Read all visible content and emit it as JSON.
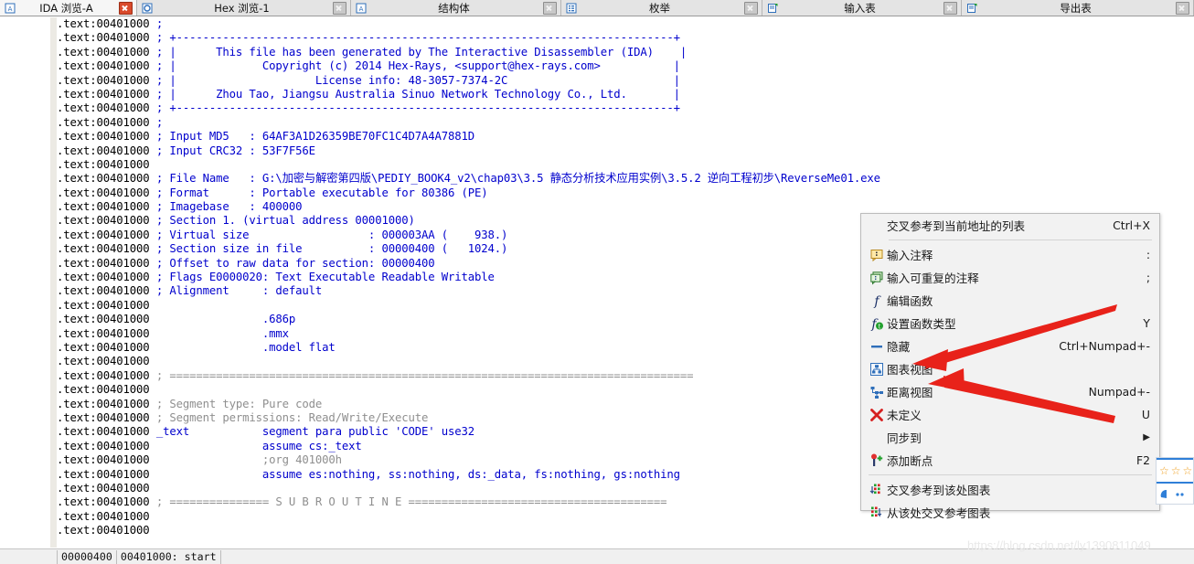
{
  "tabs": [
    {
      "label": "IDA 浏览-A",
      "icon": "ida-view-icon",
      "active": true,
      "close": "close-icon",
      "close_style": "red"
    },
    {
      "label": "Hex 浏览-1",
      "icon": "hex-view-icon",
      "active": false,
      "close": "close-icon",
      "close_style": "grey"
    },
    {
      "label": "结构体",
      "icon": "structures-icon",
      "active": false,
      "close": "close-icon",
      "close_style": "grey"
    },
    {
      "label": "枚举",
      "icon": "enums-icon",
      "active": false,
      "close": "close-icon",
      "close_style": "grey"
    },
    {
      "label": "输入表",
      "icon": "imports-icon",
      "active": false,
      "close": "close-icon",
      "close_style": "grey"
    },
    {
      "label": "导出表",
      "icon": "exports-icon",
      "active": false,
      "close": "close-icon",
      "close_style": "grey"
    }
  ],
  "disassembly": {
    "address_prefix": ".text:00401000",
    "lines": [
      {
        "color": "blue",
        "text": ";"
      },
      {
        "color": "blue",
        "text": "; +---------------------------------------------------------------------------+"
      },
      {
        "color": "blue",
        "text": "; |      This file has been generated by The Interactive Disassembler (IDA)    |"
      },
      {
        "color": "blue",
        "text": "; |             Copyright (c) 2014 Hex-Rays, <support@hex-rays.com>           |"
      },
      {
        "color": "blue",
        "text": "; |                     License info: 48-3057-7374-2C                         |"
      },
      {
        "color": "blue",
        "text": "; |      Zhou Tao, Jiangsu Australia Sinuo Network Technology Co., Ltd.       |"
      },
      {
        "color": "blue",
        "text": "; +---------------------------------------------------------------------------+"
      },
      {
        "color": "blue",
        "text": ";"
      },
      {
        "color": "blue",
        "text": "; Input MD5   : 64AF3A1D26359BE70FC1C4D7A4A7881D"
      },
      {
        "color": "blue",
        "text": "; Input CRC32 : 53F7F56E"
      },
      {
        "color": "blue",
        "text": ""
      },
      {
        "color": "blue",
        "text": "; File Name   : G:\\加密与解密第四版\\PEDIY_BOOK4_v2\\chap03\\3.5 静态分析技术应用实例\\3.5.2 逆向工程初步\\ReverseMe01.exe"
      },
      {
        "color": "blue",
        "text": "; Format      : Portable executable for 80386 (PE)"
      },
      {
        "color": "blue",
        "text": "; Imagebase   : 400000"
      },
      {
        "color": "blue",
        "text": "; Section 1. (virtual address 00001000)"
      },
      {
        "color": "blue",
        "text": "; Virtual size                  : 000003AA (    938.)"
      },
      {
        "color": "blue",
        "text": "; Section size in file          : 00000400 (   1024.)"
      },
      {
        "color": "blue",
        "text": "; Offset to raw data for section: 00000400"
      },
      {
        "color": "blue",
        "text": "; Flags E0000020: Text Executable Readable Writable"
      },
      {
        "color": "blue",
        "text": "; Alignment     : default"
      },
      {
        "color": "blue",
        "text": ""
      },
      {
        "color": "blue",
        "text": "                .686p"
      },
      {
        "color": "blue",
        "text": "                .mmx"
      },
      {
        "color": "blue",
        "text": "                .model flat"
      },
      {
        "color": "blue",
        "text": ""
      },
      {
        "color": "grey",
        "text": "; ==============================================================================="
      },
      {
        "color": "blue",
        "text": ""
      },
      {
        "color": "grey",
        "text": "; Segment type: Pure code"
      },
      {
        "color": "grey",
        "text": "; Segment permissions: Read/Write/Execute"
      },
      {
        "color": "blue",
        "text": "_text           segment para public 'CODE' use32"
      },
      {
        "color": "blue",
        "text": "                assume cs:_text"
      },
      {
        "color": "grey",
        "text": "                ;org 401000h"
      },
      {
        "color": "blue",
        "text": "                assume es:nothing, ss:nothing, ds:_data, fs:nothing, gs:nothing"
      },
      {
        "color": "blue",
        "text": ""
      },
      {
        "color": "grey",
        "text": "; =============== S U B R O U T I N E ======================================="
      },
      {
        "color": "blue",
        "text": ""
      },
      {
        "color": "blue",
        "text": ""
      }
    ]
  },
  "context_menu": {
    "items": [
      {
        "icon": null,
        "label": "交叉参考到当前地址的列表",
        "shortcut": "Ctrl+X",
        "submenu": false
      },
      {
        "separator": true
      },
      {
        "icon": "comment-bubble-icon",
        "label": "输入注释",
        "shortcut": ":",
        "submenu": false
      },
      {
        "icon": "repeatable-comment-icon",
        "label": "输入可重复的注释",
        "shortcut": ";",
        "submenu": false
      },
      {
        "icon": "function-italic-f-icon",
        "label": "编辑函数",
        "shortcut": "",
        "submenu": false
      },
      {
        "icon": "set-function-type-icon",
        "label": "设置函数类型",
        "shortcut": "Y",
        "submenu": false
      },
      {
        "icon": "hide-dash-icon",
        "label": "隐藏",
        "shortcut": "Ctrl+Numpad+-",
        "submenu": false
      },
      {
        "icon": "graph-view-icon",
        "label": "图表视图",
        "shortcut": "",
        "submenu": false
      },
      {
        "icon": "proximity-view-icon",
        "label": "距离视图",
        "shortcut": "Numpad+-",
        "submenu": false
      },
      {
        "icon": "undefine-x-icon",
        "label": "未定义",
        "shortcut": "U",
        "submenu": false
      },
      {
        "icon": null,
        "label": "同步到",
        "shortcut": "",
        "submenu": true
      },
      {
        "icon": "breakpoint-icon",
        "label": "添加断点",
        "shortcut": "F2",
        "submenu": false
      },
      {
        "separator": true
      },
      {
        "icon": "xrefs-to-graph-icon",
        "label": "交叉参考到该处图表",
        "shortcut": "",
        "submenu": false
      },
      {
        "icon": "xrefs-from-graph-icon",
        "label": "从该处交叉参考图表",
        "shortcut": "",
        "submenu": false
      }
    ]
  },
  "status_bar": {
    "file_offset": "00000400",
    "location": "00401000: start"
  },
  "watermark": "https://blog.csdn.net/ly1390811049",
  "colors": {
    "comment_blue": "#0000cd",
    "auto_comment_grey": "#8f8f8f",
    "address_black": "#000000",
    "arrow_red": "#e8221a",
    "accent_tab_close_red": "#d94a2b"
  }
}
